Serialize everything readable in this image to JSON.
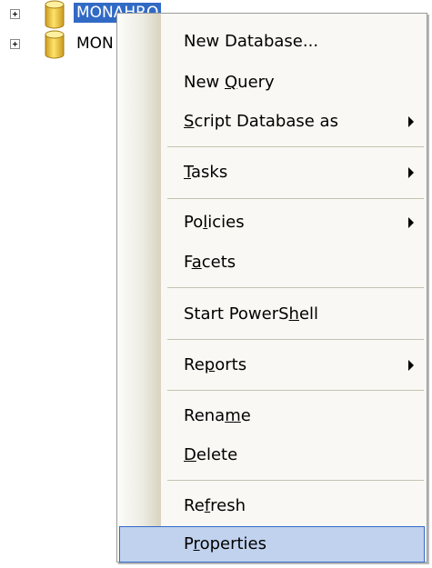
{
  "tree": {
    "nodes": [
      {
        "label": "MONAHRO",
        "selected": true
      },
      {
        "label": "MON",
        "selected": false
      }
    ]
  },
  "context_menu": {
    "items": [
      {
        "label": "New Database...",
        "mnemonic": "",
        "submenu": false
      },
      {
        "label": "New Query",
        "mnemonic": "Q",
        "submenu": false
      },
      {
        "label": "Script Database as",
        "mnemonic": "S",
        "submenu": true
      },
      {
        "label": "Tasks",
        "mnemonic": "T",
        "submenu": true
      },
      {
        "label": "Policies",
        "mnemonic": "l",
        "submenu": true
      },
      {
        "label": "Facets",
        "mnemonic": "a",
        "submenu": false
      },
      {
        "label": "Start PowerShell",
        "mnemonic": "h",
        "submenu": false
      },
      {
        "label": "Reports",
        "mnemonic": "p",
        "submenu": true
      },
      {
        "label": "Rename",
        "mnemonic": "m",
        "submenu": false
      },
      {
        "label": "Delete",
        "mnemonic": "D",
        "submenu": false
      },
      {
        "label": "Refresh",
        "mnemonic": "f",
        "submenu": false
      },
      {
        "label": "Properties",
        "mnemonic": "r",
        "submenu": false,
        "highlighted": true
      }
    ]
  },
  "colors": {
    "selection": "#316ac5",
    "menu_hover": "#c1d2ee",
    "menu_background": "#f9f8f4"
  }
}
